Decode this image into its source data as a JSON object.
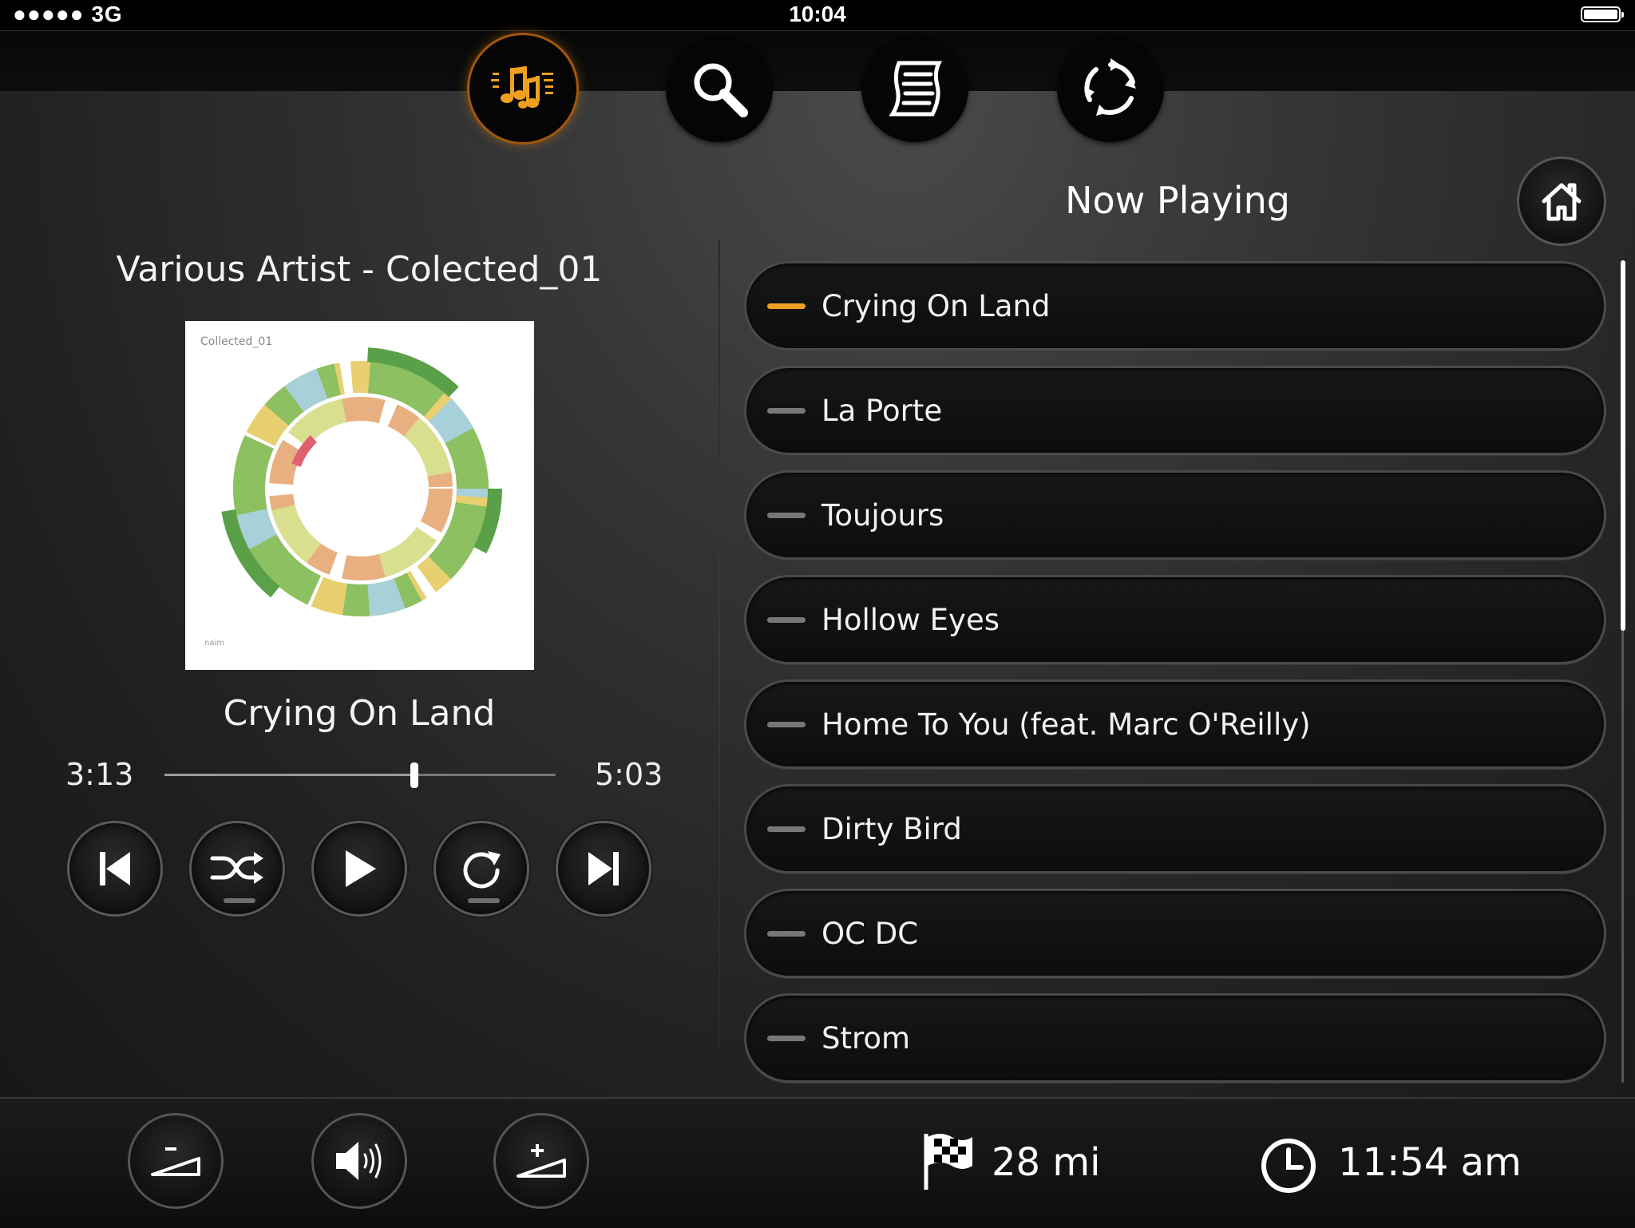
{
  "status_bar": {
    "signal": "●●●●● 3G",
    "time": "10:04"
  },
  "top_nav": [
    {
      "name": "music",
      "icon": "music-notes-icon",
      "active": true
    },
    {
      "name": "search",
      "icon": "search-icon",
      "active": false
    },
    {
      "name": "playlist",
      "icon": "scroll-list-icon",
      "active": false
    },
    {
      "name": "sync",
      "icon": "sync-icon",
      "active": false
    }
  ],
  "now_playing": {
    "album_title": "Various Artist - Colected_01",
    "album_art_caption": "Collected_01",
    "album_art_logo": "naim",
    "track_title": "Crying On Land",
    "elapsed": "3:13",
    "duration": "5:03",
    "progress_fraction": 0.639
  },
  "controls": [
    "previous-icon",
    "shuffle-icon",
    "play-icon",
    "repeat-icon",
    "next-icon"
  ],
  "playlist": {
    "title": "Now Playing",
    "tracks": [
      {
        "name": "Crying On Land",
        "playing": true
      },
      {
        "name": "La Porte",
        "playing": false
      },
      {
        "name": "Toujours",
        "playing": false
      },
      {
        "name": "Hollow Eyes",
        "playing": false
      },
      {
        "name": "Home To You (feat. Marc O'Reilly)",
        "playing": false
      },
      {
        "name": "Dirty Bird",
        "playing": false
      },
      {
        "name": "OC DC",
        "playing": false
      },
      {
        "name": "Strom",
        "playing": false
      }
    ]
  },
  "bottom_bar": {
    "distance": "28 mi",
    "clock": "11:54 am"
  },
  "colors": {
    "accent": "#f0a020",
    "background": "#222222"
  }
}
